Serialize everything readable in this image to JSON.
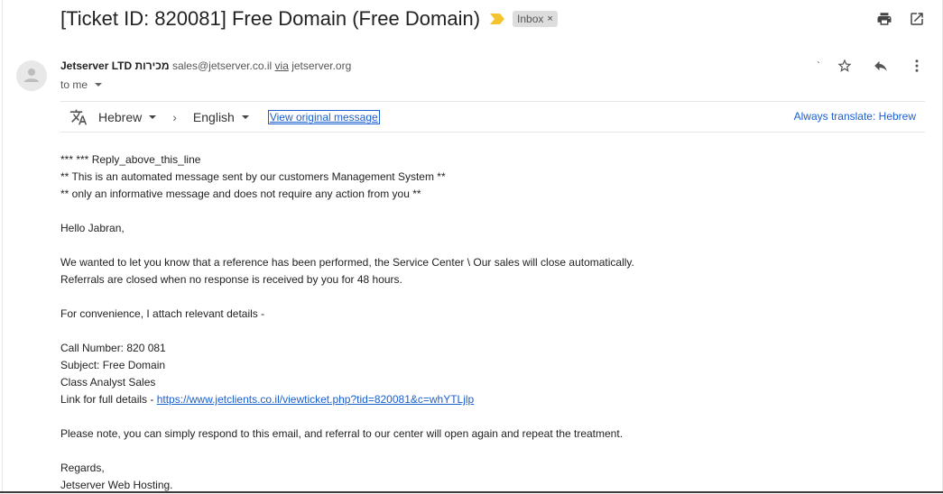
{
  "email": {
    "subject": "[Ticket ID: 820081] Free Domain (Free Domain)",
    "label": "Inbox",
    "label_remove": "×",
    "sender": {
      "name": "Jetserver LTD מכירות",
      "email": "sales@jetserver.co.il",
      "via_word": "via",
      "via_domain": "jetserver.org",
      "tick": "`"
    },
    "recipient": "to me"
  },
  "translate": {
    "source_lang": "Hebrew",
    "chevron": "›",
    "target_lang": "English",
    "view_original": "View original message",
    "always_translate": "Always translate: Hebrew"
  },
  "body": {
    "lines": [
      "*** *** Reply_above_this_line",
      "** This is an automated message sent by our customers Management System **",
      "** only an informative message and does not require any action from you **",
      "Hello Jabran,",
      "We wanted to let you know that a reference has been performed, the Service Center \\ Our sales will close automatically.",
      "Referrals are closed when no response is received by you for 48 hours.",
      "For convenience, I attach relevant details -",
      "Call Number: 820 081",
      "Subject: Free Domain",
      "Class Analyst Sales",
      "Link for full details - ",
      "Please note, you can simply respond to this email, and referral to our center will open again and repeat the treatment.",
      "Regards,",
      "Jetserver Web Hosting."
    ],
    "link": "https://www.jetclients.co.il/viewticket.php?tid=820081&c=whYTLjlp"
  },
  "icons": {
    "importance": "importance-marker-icon",
    "print": "print-icon",
    "open_new_window": "open-in-new-window-icon",
    "avatar": "avatar-person-icon",
    "star": "star-icon",
    "reply": "reply-icon",
    "more": "more-vertical-icon",
    "translate": "translate-icon"
  },
  "colors": {
    "link": "#1a5fd0",
    "importance": "#f4c430",
    "label_bg": "#dddddd"
  }
}
